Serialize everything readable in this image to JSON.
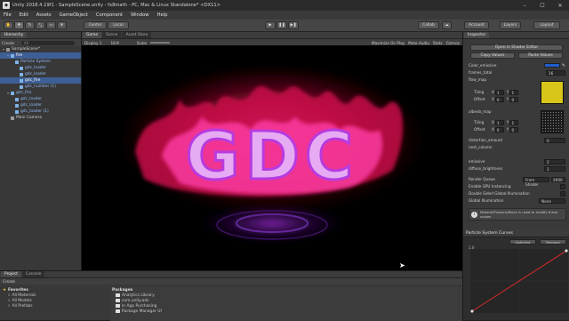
{
  "window": {
    "title": "Unity 2018.4.19f1 - SampleScene.unity - fx8math - PC, Mac & Linux Standalone* <DX11>",
    "logo": "unity-logo-icon"
  },
  "menu": [
    "File",
    "Edit",
    "Assets",
    "GameObject",
    "Component",
    "Window",
    "Help"
  ],
  "toolbar": {
    "center_label": "Center",
    "local_label": "Local",
    "collab_label": "Collab",
    "account_label": "Account",
    "layers_label": "Layers",
    "layout_label": "Layout"
  },
  "hierarchy": {
    "tab_label": "Hierarchy",
    "create_label": "Create",
    "search_placeholder": "All",
    "rows": [
      {
        "label": "SampleScene*",
        "depth": 0,
        "icon": "scene",
        "selected": false,
        "blue": false
      },
      {
        "label": "fire",
        "depth": 1,
        "icon": "cube",
        "selected": true,
        "blue": false
      },
      {
        "label": "Particle System",
        "depth": 2,
        "icon": "cube",
        "selected": false,
        "blue": true
      },
      {
        "label": "gdc_loader",
        "depth": 3,
        "icon": "cube",
        "selected": false,
        "blue": true
      },
      {
        "label": "gdc_loader",
        "depth": 3,
        "icon": "cube",
        "selected": false,
        "blue": true
      },
      {
        "label": "gdc_fire",
        "depth": 3,
        "icon": "cube",
        "selected": true,
        "blue": false
      },
      {
        "label": "gdc_number (1)",
        "depth": 3,
        "icon": "cube",
        "selected": false,
        "blue": true
      },
      {
        "label": "gdc_fire",
        "depth": 1,
        "icon": "cube",
        "selected": false,
        "blue": true
      },
      {
        "label": "gdc_loader",
        "depth": 2,
        "icon": "cube",
        "selected": false,
        "blue": true
      },
      {
        "label": "gdc_loader",
        "depth": 2,
        "icon": "cube",
        "selected": false,
        "blue": true
      },
      {
        "label": "gdc_loader (1)",
        "depth": 2,
        "icon": "cube",
        "selected": false,
        "blue": true
      },
      {
        "label": "Main Camera",
        "depth": 1,
        "icon": "camera",
        "selected": false,
        "blue": false
      }
    ]
  },
  "gameview": {
    "tabs": [
      "Game",
      "Scene",
      "Asset Store"
    ],
    "display_label": "Display 1",
    "aspect_label": "16:9",
    "scale_label": "Scale",
    "maximize_label": "Maximize On Play",
    "mute_label": "Mute Audio",
    "stats_label": "Stats",
    "gizmos_label": "Gizmos",
    "effect_text": "GDC"
  },
  "inspector": {
    "tab_label": "Inspector",
    "header_button": "Open in Shader Editor",
    "copy_values": "Copy Values",
    "paste_values": "Paste Values",
    "color_emissive": "Color_emissive",
    "frames_total": "frames_total",
    "frames_total_value": "16",
    "flow_map": "flow_map",
    "tiling_label": "Tiling",
    "offset_label": "Offset",
    "tiling_x": "1",
    "tiling_y": "1",
    "offset_x": "0",
    "offset_y": "0",
    "select_label": "Select",
    "albedo_map": "albedo_map",
    "distortion_amount": "distortion_amount",
    "distortion_value": "0",
    "nest_column": "nest_column",
    "emissive": "emissive",
    "emissive_value": "2",
    "diffuse_brightness": "diffuse_brightness",
    "diffuse_value": "1",
    "render_queue": "Render Queue",
    "render_queue_mode": "From Shader",
    "render_queue_value": "2000",
    "gpu_instancing": "Enable GPU Instancing",
    "double_sided": "Double Sided Global Illumination",
    "global_illumination": "Global Illumination",
    "gi_value": "None",
    "info_text": "MaterialPropertyBlock is used to modify these values",
    "accent_color": "#1f5fd0",
    "flow_color": "#d8c61a"
  },
  "curves": {
    "title": "Particle System Curves",
    "optimize_label": "Optimize",
    "remove_label": "Remove",
    "y_max": "1.0",
    "curve_color": "#d82a2a"
  },
  "project": {
    "tabs": [
      "Project",
      "Console"
    ],
    "create_label": "Create",
    "favorites_label": "Favorites",
    "favorites": [
      "All Materials",
      "All Models",
      "All Prefabs"
    ],
    "packages_label": "Packages",
    "packages": [
      "Analytics Library",
      "com.unity.ads",
      "In App Purchasing",
      "Package Manager UI"
    ]
  }
}
